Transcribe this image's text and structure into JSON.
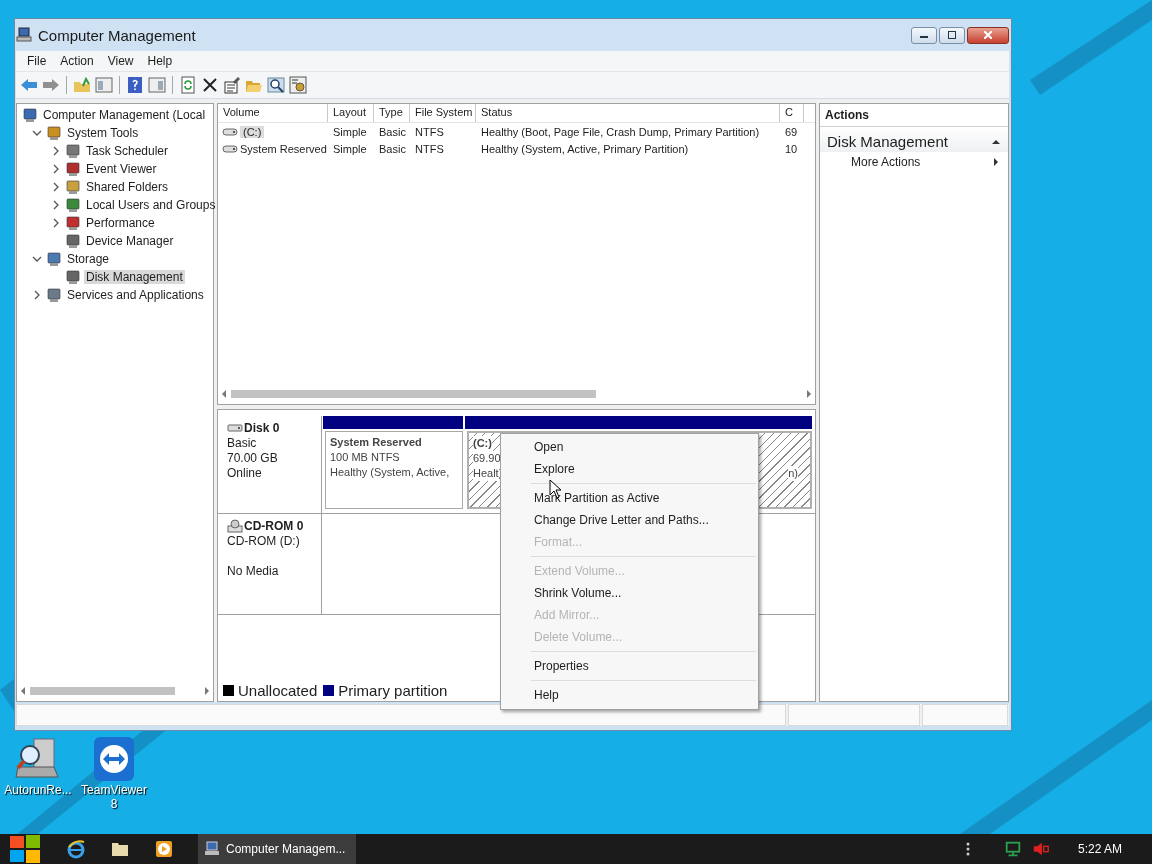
{
  "window": {
    "title": "Computer Management"
  },
  "menu_bar": [
    "File",
    "Action",
    "View",
    "Help"
  ],
  "tree": [
    {
      "label": "Computer Management (Local",
      "selected": false,
      "children": [
        {
          "label": "System Tools",
          "expanded": true,
          "selected": false,
          "children": [
            {
              "label": "Task Scheduler",
              "expanded": false,
              "selected": false
            },
            {
              "label": "Event Viewer",
              "expanded": false,
              "selected": false
            },
            {
              "label": "Shared Folders",
              "expanded": false,
              "selected": false
            },
            {
              "label": "Local Users and Groups",
              "expanded": false,
              "selected": false
            },
            {
              "label": "Performance",
              "expanded": false,
              "selected": false
            },
            {
              "label": "Device Manager",
              "selected": false
            }
          ]
        },
        {
          "label": "Storage",
          "expanded": true,
          "selected": false,
          "children": [
            {
              "label": "Disk Management",
              "selected": true
            }
          ]
        },
        {
          "label": "Services and Applications",
          "expanded": false,
          "selected": false
        }
      ]
    }
  ],
  "volume_table": {
    "columns": [
      "Volume",
      "Layout",
      "Type",
      "File System",
      "Status",
      "C"
    ],
    "rows": [
      {
        "selected": true,
        "cells": [
          "(C:)",
          "Simple",
          "Basic",
          "NTFS",
          "Healthy (Boot, Page File, Crash Dump, Primary Partition)",
          "69"
        ]
      },
      {
        "selected": false,
        "cells": [
          "System Reserved",
          "Simple",
          "Basic",
          "NTFS",
          "Healthy (System, Active, Primary Partition)",
          "10"
        ]
      }
    ]
  },
  "disks": [
    {
      "kind": "disk",
      "name": "Disk 0",
      "type": "Basic",
      "size": "70.00 GB",
      "status": "Online",
      "partitions": [
        {
          "title": "System Reserved",
          "lines": [
            "100 MB NTFS",
            "Healthy (System, Active,"
          ],
          "selected": false
        },
        {
          "title": "(C:)",
          "lines": [
            "69.90",
            "Healt"
          ],
          "tail": "n)",
          "selected": true
        }
      ]
    },
    {
      "kind": "cdrom",
      "name": "CD-ROM 0",
      "type": "CD-ROM (D:)",
      "status": "No Media"
    }
  ],
  "legend": [
    {
      "label": "Unallocated",
      "color": "#000000"
    },
    {
      "label": "Primary partition",
      "color": "#000080"
    }
  ],
  "actions": {
    "header": "Actions",
    "section": {
      "title": "Disk Management",
      "expanded": true,
      "items": [
        "More Actions"
      ]
    }
  },
  "context_menu": [
    {
      "kind": "item",
      "label": "Open",
      "disabled": false
    },
    {
      "kind": "item",
      "label": "Explore",
      "disabled": false
    },
    {
      "kind": "separator"
    },
    {
      "kind": "item",
      "label": "Mark Partition as Active",
      "disabled": false
    },
    {
      "kind": "item",
      "label": "Change Drive Letter and Paths...",
      "disabled": false
    },
    {
      "kind": "item",
      "label": "Format...",
      "disabled": true
    },
    {
      "kind": "separator"
    },
    {
      "kind": "item",
      "label": "Extend Volume...",
      "disabled": true
    },
    {
      "kind": "item",
      "label": "Shrink Volume...",
      "disabled": false
    },
    {
      "kind": "item",
      "label": "Add Mirror...",
      "disabled": true
    },
    {
      "kind": "item",
      "label": "Delete Volume...",
      "disabled": true
    },
    {
      "kind": "separator"
    },
    {
      "kind": "item",
      "label": "Properties",
      "disabled": false
    },
    {
      "kind": "separator"
    },
    {
      "kind": "item",
      "label": "Help",
      "disabled": false
    }
  ],
  "desktop_icons": [
    {
      "label": "AutorunRe...",
      "kind": "autorun"
    },
    {
      "label": "TeamViewer 8",
      "kind": "teamviewer"
    }
  ],
  "taskbar": {
    "task": "Computer Managem...",
    "clock": "5:22 AM"
  }
}
